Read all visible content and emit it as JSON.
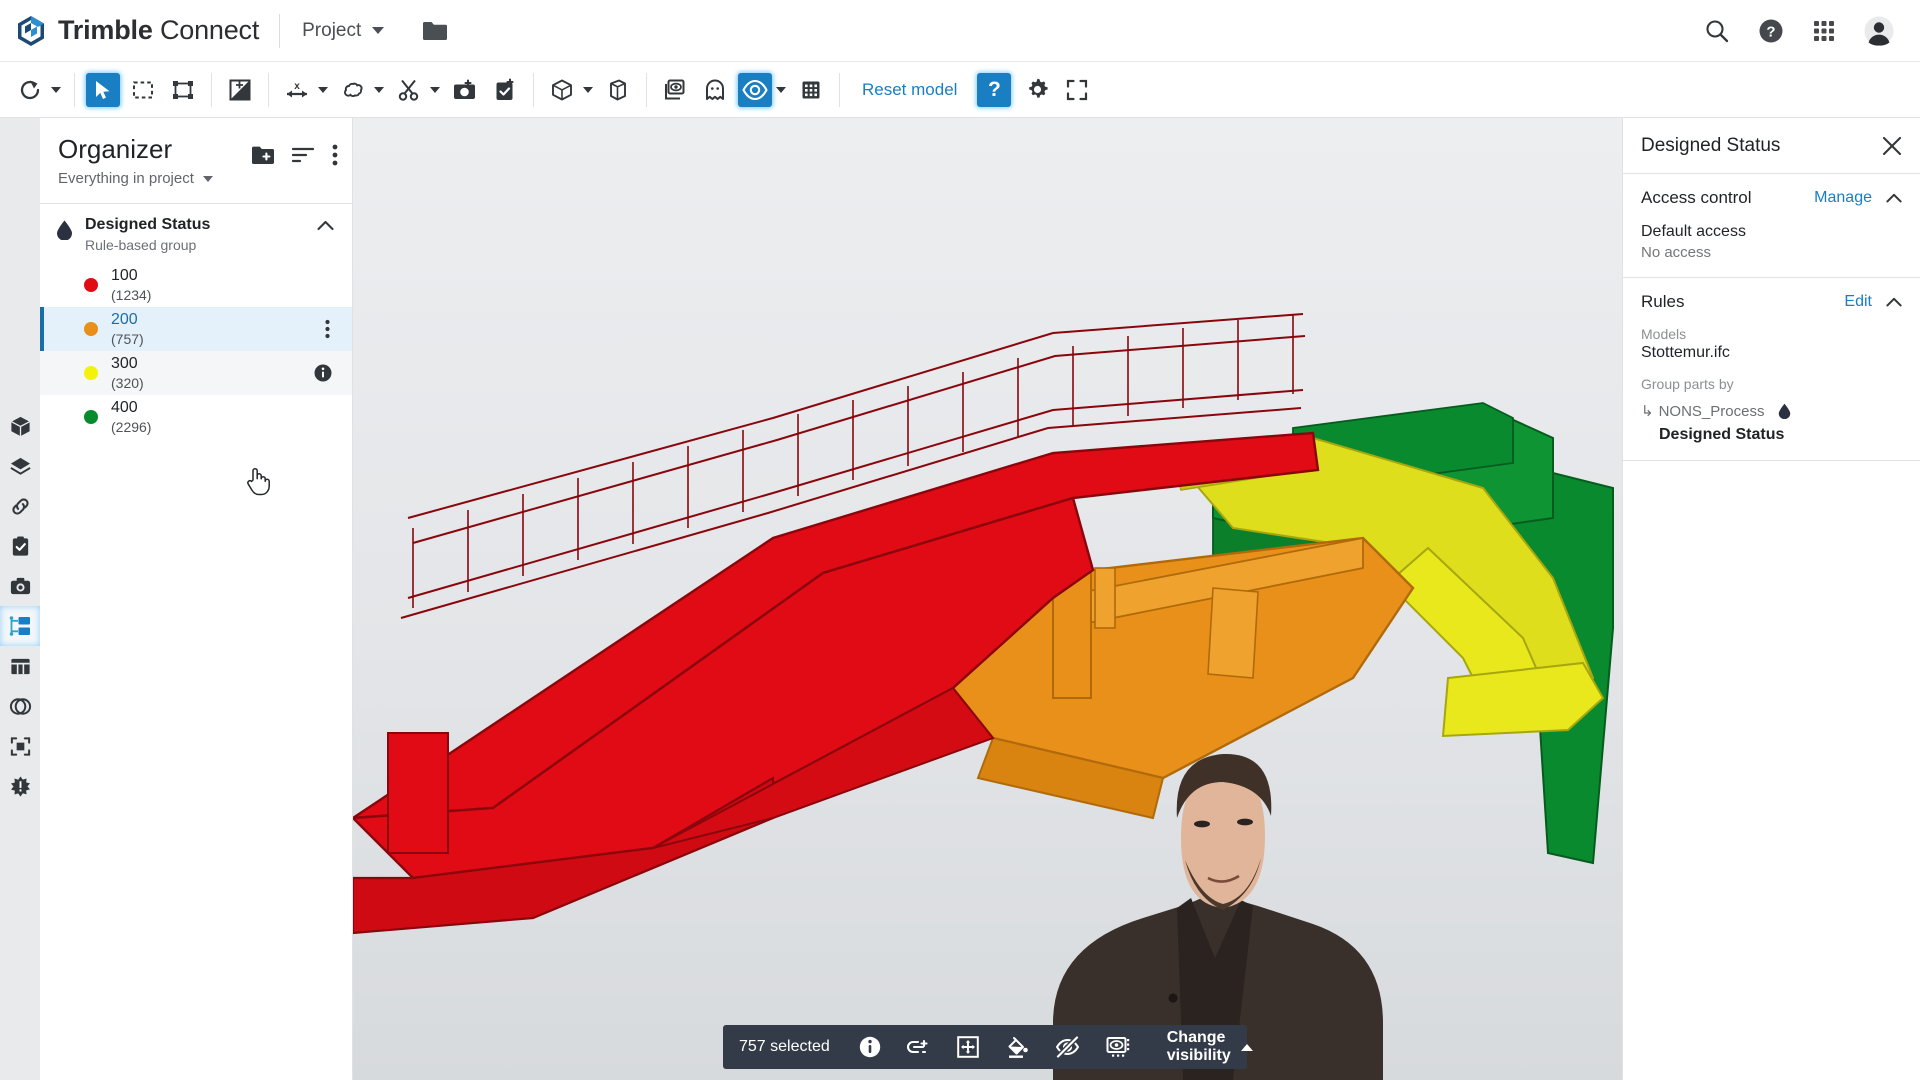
{
  "header": {
    "brand_bold": "Trimble",
    "brand_light": "Connect",
    "project_label": "Project",
    "folder_icon": "folder-icon",
    "icons": {
      "search": "search-icon",
      "help": "help-circle-icon",
      "apps": "apps-grid-icon",
      "account": "user-avatar-icon"
    }
  },
  "toolbar": {
    "reset_label": "Reset model",
    "help_label": "?",
    "buttons": [
      {
        "name": "orbit-icon",
        "active": false,
        "caret": true
      },
      {
        "name": "select-pointer-icon",
        "active": true,
        "caret": false
      },
      {
        "name": "rectangle-select-icon",
        "active": false,
        "caret": false
      },
      {
        "name": "bounding-box-select-icon",
        "active": false,
        "caret": false
      },
      {
        "name": "contrast-adjust-icon",
        "active": false,
        "caret": false
      },
      {
        "name": "measure-distance-icon",
        "active": false,
        "caret": true
      },
      {
        "name": "markup-cloud-icon",
        "active": false,
        "caret": true
      },
      {
        "name": "clip-scissors-icon",
        "active": false,
        "caret": true
      },
      {
        "name": "snapshot-add-icon",
        "active": false,
        "caret": false
      },
      {
        "name": "todo-add-icon",
        "active": false,
        "caret": false
      },
      {
        "name": "view-cube-icon",
        "active": false,
        "caret": true
      },
      {
        "name": "section-box-icon",
        "active": false,
        "caret": false
      },
      {
        "name": "layers-eye-icon",
        "active": false,
        "caret": false
      },
      {
        "name": "ghost-transparency-icon",
        "active": false,
        "caret": false
      },
      {
        "name": "visibility-eye-icon",
        "active": true,
        "caret": true
      },
      {
        "name": "grid-icon",
        "active": false,
        "caret": false
      },
      {
        "name": "settings-gear-icon",
        "active": false,
        "caret": false
      },
      {
        "name": "fullscreen-icon",
        "active": false,
        "caret": false
      }
    ]
  },
  "rail": {
    "items": [
      {
        "name": "models-cube-icon",
        "selected": false
      },
      {
        "name": "layers-icon",
        "selected": false
      },
      {
        "name": "links-icon",
        "selected": false
      },
      {
        "name": "todo-clipboard-icon",
        "selected": false
      },
      {
        "name": "views-camera-icon",
        "selected": false
      },
      {
        "name": "organizer-icon",
        "selected": true
      },
      {
        "name": "table-columns-icon",
        "selected": false
      },
      {
        "name": "clash-icon",
        "selected": false
      },
      {
        "name": "selection-set-icon",
        "selected": false
      },
      {
        "name": "extensions-icon",
        "selected": false
      }
    ]
  },
  "organizer": {
    "title": "Organizer",
    "scope": "Everything in project",
    "actions": {
      "new_folder": "new-folder-icon",
      "sort": "sort-icon",
      "more": "more-options-icon"
    },
    "group": {
      "name": "Designed Status",
      "type": "Rule-based group",
      "collapse_icon": "chevron-up-icon"
    },
    "rows": [
      {
        "label": "100",
        "count": "(1234)",
        "color": "#e00b14",
        "state": "normal"
      },
      {
        "label": "200",
        "count": "(757)",
        "color": "#e8901a",
        "state": "selected"
      },
      {
        "label": "300",
        "count": "(320)",
        "color": "#f2f20a",
        "state": "hovered"
      },
      {
        "label": "400",
        "count": "(2296)",
        "color": "#0a8a2e",
        "state": "normal"
      }
    ]
  },
  "statusbar": {
    "selected_text": "757 selected",
    "change_visibility": "Change visibility",
    "icons": [
      {
        "name": "info-icon"
      },
      {
        "name": "link-add-icon"
      },
      {
        "name": "zoom-to-selection-icon"
      },
      {
        "name": "paint-color-icon"
      },
      {
        "name": "hide-eye-off-icon"
      },
      {
        "name": "isolate-icon"
      }
    ]
  },
  "rightpanel": {
    "title": "Designed Status",
    "close_icon": "close-icon",
    "access": {
      "title": "Access control",
      "link": "Manage",
      "key": "Default access",
      "value": "No access"
    },
    "rules": {
      "title": "Rules",
      "link": "Edit",
      "models_label": "Models",
      "models_value": "Stottemur.ifc",
      "group_by_label": "Group parts by",
      "property": "NONS_Process",
      "property_value": "Designed Status",
      "arrow": "↳"
    }
  },
  "viewport": {
    "model_name": "bridge-3d-model",
    "colors": {
      "red": "#e00b14",
      "orange": "#e8901a",
      "yellow": "#e8e81c",
      "green": "#0a8a2e"
    }
  }
}
